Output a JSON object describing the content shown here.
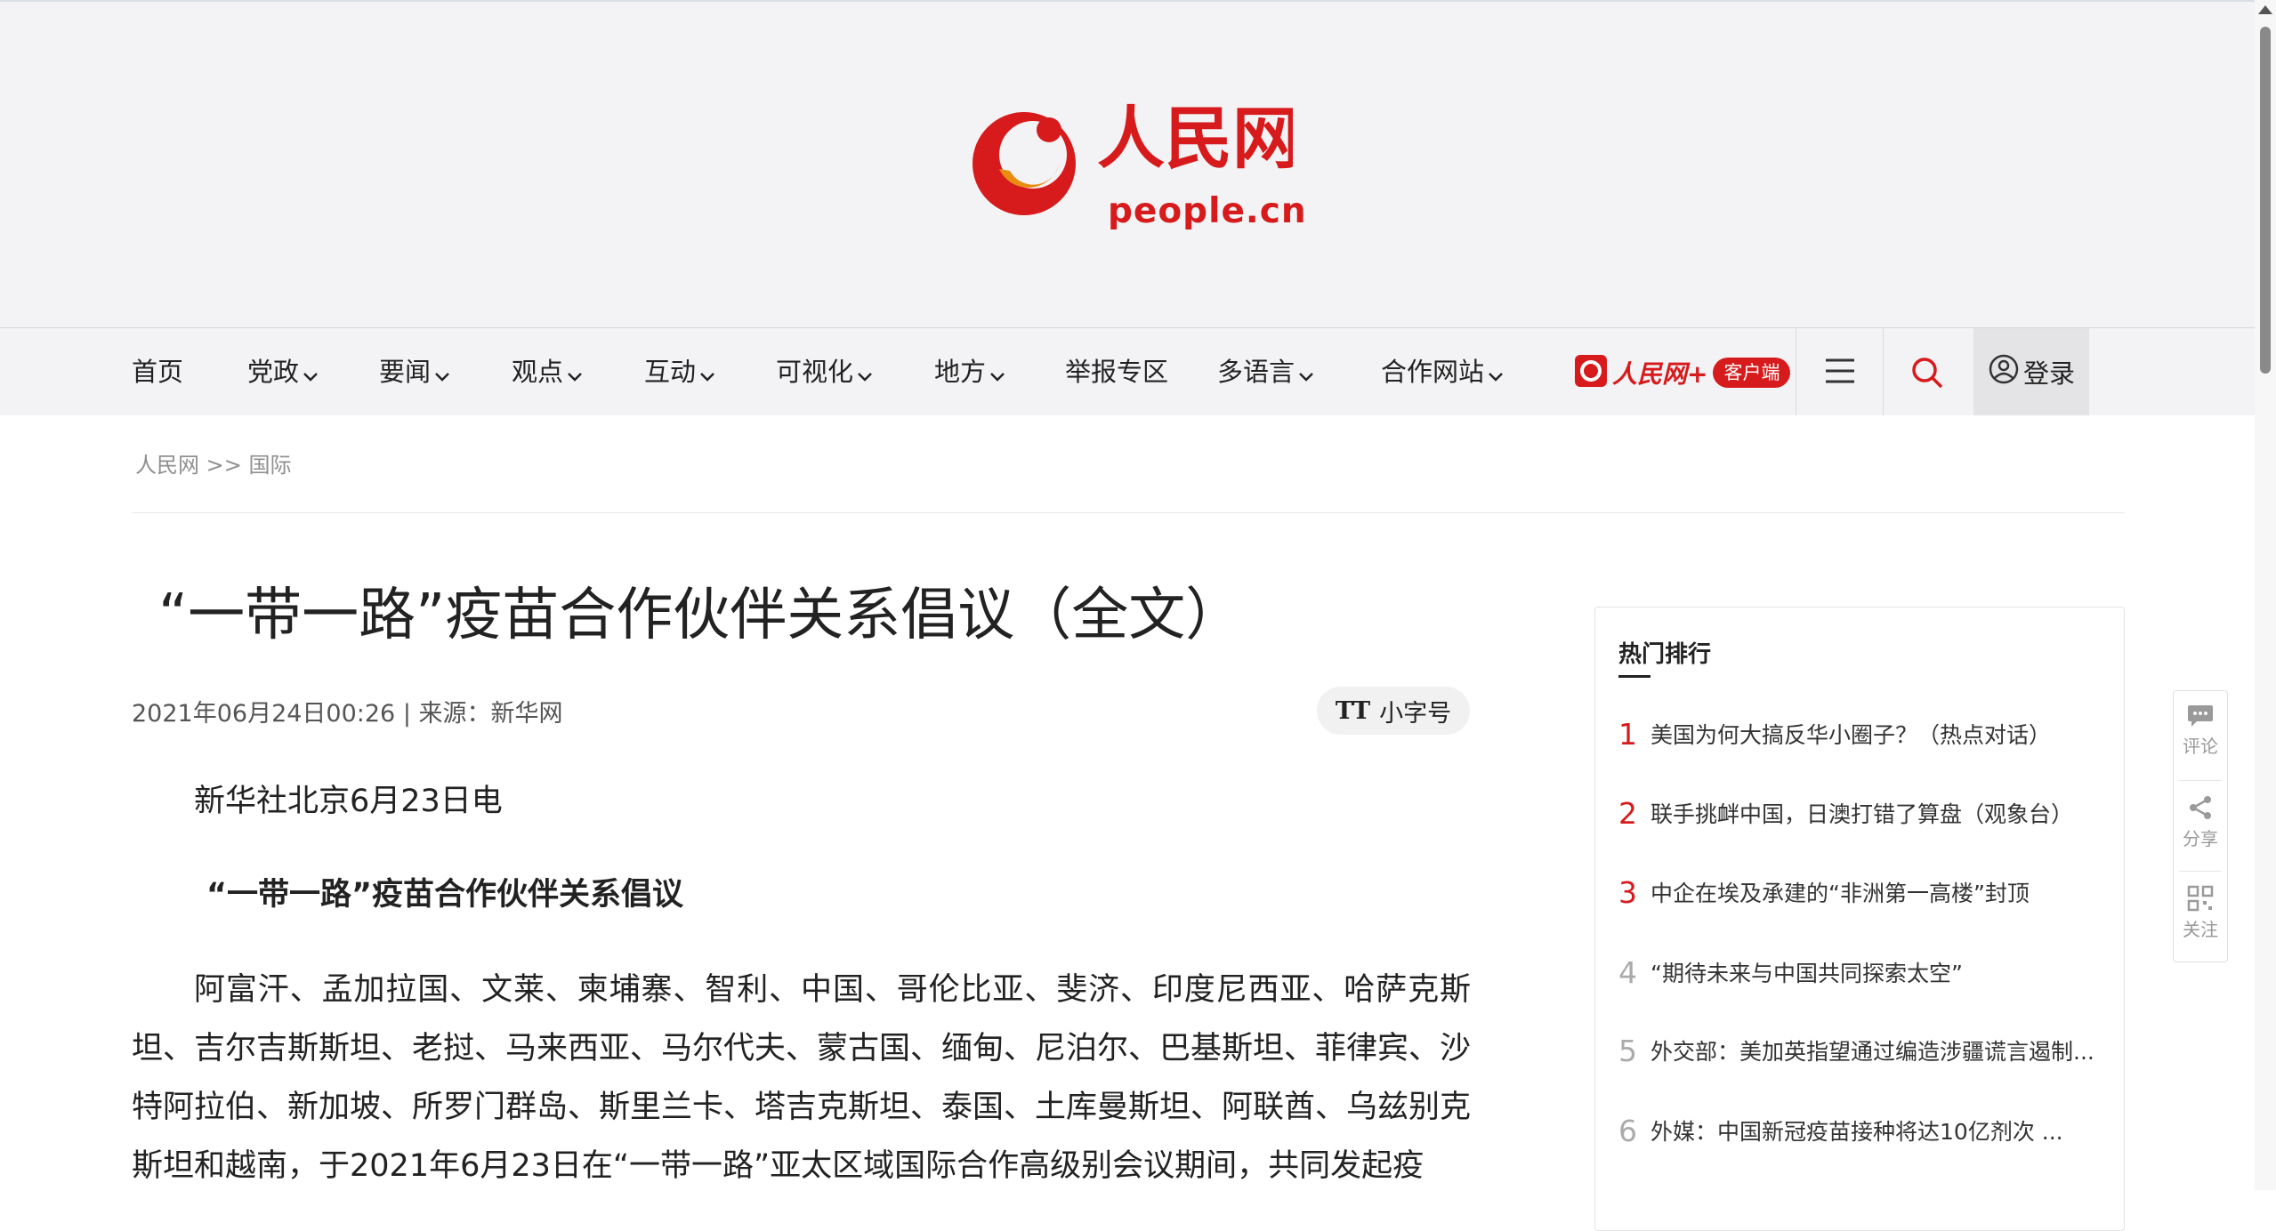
{
  "brand": {
    "logo_text": "人民网",
    "domain": "people.cn",
    "accent": "#d71a1b"
  },
  "nav": {
    "items": [
      {
        "label": "首页",
        "has_dropdown": false
      },
      {
        "label": "党政",
        "has_dropdown": true
      },
      {
        "label": "要闻",
        "has_dropdown": true
      },
      {
        "label": "观点",
        "has_dropdown": true
      },
      {
        "label": "互动",
        "has_dropdown": true
      },
      {
        "label": "可视化",
        "has_dropdown": true
      },
      {
        "label": "地方",
        "has_dropdown": true
      },
      {
        "label": "举报专区",
        "has_dropdown": false
      },
      {
        "label": "多语言",
        "has_dropdown": true
      },
      {
        "label": "合作网站",
        "has_dropdown": true
      }
    ],
    "app_badge": {
      "name": "人民网+",
      "pill": "客户端"
    },
    "menu_icon": "hamburger-icon",
    "search_icon": "search-icon",
    "login_label": "登录"
  },
  "breadcrumb": {
    "root": "人民网",
    "separator": ">>",
    "section": "国际"
  },
  "article": {
    "title": "“一带一路”疫苗合作伙伴关系倡议（全文）",
    "date": "2021年06月24日00:26",
    "source_sep": "|",
    "source_label": "来源：",
    "source": "新华网",
    "font_toggle": "小字号",
    "font_toggle_icon": "TT",
    "dateline": "新华社北京6月23日电",
    "subtitle": "“一带一路”疫苗合作伙伴关系倡议",
    "body": "阿富汗、孟加拉国、文莱、柬埔寨、智利、中国、哥伦比亚、斐济、印度尼西亚、哈萨克斯坦、吉尔吉斯斯坦、老挝、马来西亚、马尔代夫、蒙古国、缅甸、尼泊尔、巴基斯坦、菲律宾、沙特阿拉伯、新加坡、所罗门群岛、斯里兰卡、塔吉克斯坦、泰国、土库曼斯坦、阿联酋、乌兹别克斯坦和越南，于2021年6月23日在“一带一路”亚太区域国际合作高级别会议期间，共同发起疫"
  },
  "ranking": {
    "title": "热门排行",
    "items": [
      {
        "num": "1",
        "text": "美国为何大搞反华小圈子？（热点对话）"
      },
      {
        "num": "2",
        "text": "联手挑衅中国，日澳打错了算盘（观象台）"
      },
      {
        "num": "3",
        "text": "中企在埃及承建的“非洲第一高楼”封顶"
      },
      {
        "num": "4",
        "text": "“期待未来与中国共同探索太空”"
      },
      {
        "num": "5",
        "text": "外交部：美加英指望通过编造涉疆谎言遏制..."
      },
      {
        "num": "6",
        "text": "外媒：中国新冠疫苗接种将达10亿剂次 ..."
      }
    ]
  },
  "side_tools": [
    {
      "label": "评论",
      "icon": "comment-icon"
    },
    {
      "label": "分享",
      "icon": "share-icon"
    },
    {
      "label": "关注",
      "icon": "qrcode-icon"
    }
  ]
}
